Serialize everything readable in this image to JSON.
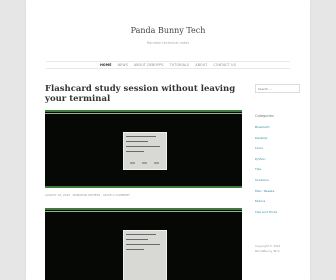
{
  "site": {
    "title": "Panda Bunny Tech",
    "tagline": "Random technical notes"
  },
  "nav": {
    "items": [
      "HOME",
      "NEWS",
      "ABOUT DEBOPPS",
      "TUTORIALS",
      "ABOUT",
      "CONTACT US"
    ],
    "active_index": 0
  },
  "post": {
    "title": "Flashcard study session without leaving your terminal",
    "meta": "AUGUST 16, 2020  ·  MANOHAR MAHESH  ·  LEAVE A COMMENT"
  },
  "sidebar": {
    "search_placeholder": "Search ...",
    "categories_heading": "Categories",
    "categories": [
      "Bluetooth",
      "Desktop",
      "Linux",
      "Python",
      "Tips",
      "Solutions",
      "Misc. Tweaks",
      "Fedora",
      "Tips and Tricks"
    ],
    "copyright_line1": "Copyright © 2021",
    "copyright_line2": "PandaBunny Tech"
  },
  "colors": {
    "accent": "#2d8a9e",
    "terminal_bg": "#050805",
    "terminal_bar": "#3f7a3f"
  }
}
